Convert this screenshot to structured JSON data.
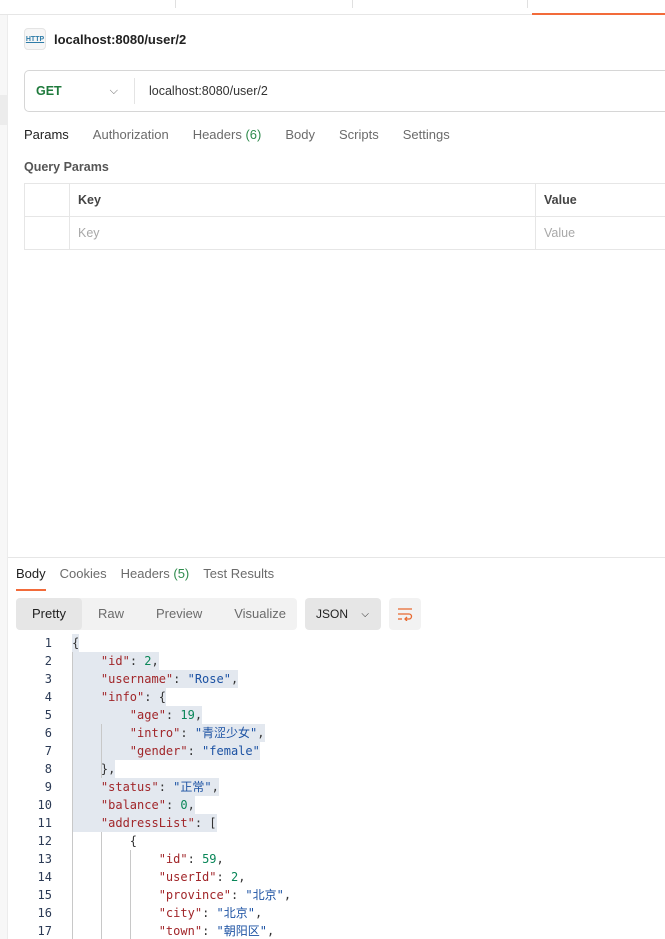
{
  "request": {
    "title": "localhost:8080/user/2",
    "icon": "http-icon",
    "icon_text": "HTTP",
    "method": "GET",
    "url": "localhost:8080/user/2"
  },
  "request_tabs": [
    {
      "label": "Params"
    },
    {
      "label": "Authorization"
    },
    {
      "label": "Headers",
      "count": "(6)"
    },
    {
      "label": "Body"
    },
    {
      "label": "Scripts"
    },
    {
      "label": "Settings"
    }
  ],
  "query_params": {
    "label": "Query Params",
    "columns": [
      "Key",
      "Value"
    ],
    "placeholders": [
      "Key",
      "Value"
    ]
  },
  "response_tabs": [
    {
      "label": "Body"
    },
    {
      "label": "Cookies"
    },
    {
      "label": "Headers",
      "count": "(5)"
    },
    {
      "label": "Test Results"
    }
  ],
  "view_modes": [
    "Pretty",
    "Raw",
    "Preview",
    "Visualize"
  ],
  "format": "JSON",
  "colors": {
    "accent": "#f26b3a",
    "method": "#1f7a3c",
    "key": "#a1262a",
    "string": "#1c52a3",
    "number": "#098658"
  },
  "code_lines": [
    {
      "n": "1",
      "hl": true,
      "tokens": [
        [
          "p",
          "{"
        ]
      ]
    },
    {
      "n": "2",
      "hl": true,
      "tokens": [
        [
          "p",
          "    "
        ],
        [
          "k",
          "\"id\""
        ],
        [
          "p",
          ": "
        ],
        [
          "n",
          "2"
        ],
        [
          "p",
          ","
        ]
      ]
    },
    {
      "n": "3",
      "hl": true,
      "tokens": [
        [
          "p",
          "    "
        ],
        [
          "k",
          "\"username\""
        ],
        [
          "p",
          ": "
        ],
        [
          "s",
          "\"Rose\""
        ],
        [
          "p",
          ","
        ]
      ]
    },
    {
      "n": "4",
      "hl": true,
      "tokens": [
        [
          "p",
          "    "
        ],
        [
          "k",
          "\"info\""
        ],
        [
          "p",
          ": {"
        ]
      ]
    },
    {
      "n": "5",
      "hl": true,
      "tokens": [
        [
          "p",
          "        "
        ],
        [
          "k",
          "\"age\""
        ],
        [
          "p",
          ": "
        ],
        [
          "n",
          "19"
        ],
        [
          "p",
          ","
        ]
      ]
    },
    {
      "n": "6",
      "hl": true,
      "tokens": [
        [
          "p",
          "        "
        ],
        [
          "k",
          "\"intro\""
        ],
        [
          "p",
          ": "
        ],
        [
          "s",
          "\"青涩少女\""
        ],
        [
          "p",
          ","
        ]
      ]
    },
    {
      "n": "7",
      "hl": true,
      "tokens": [
        [
          "p",
          "        "
        ],
        [
          "k",
          "\"gender\""
        ],
        [
          "p",
          ": "
        ],
        [
          "s",
          "\"female\""
        ]
      ]
    },
    {
      "n": "8",
      "hl": true,
      "tokens": [
        [
          "p",
          "    },"
        ]
      ]
    },
    {
      "n": "9",
      "hl": true,
      "tokens": [
        [
          "p",
          "    "
        ],
        [
          "k",
          "\"status\""
        ],
        [
          "p",
          ": "
        ],
        [
          "s",
          "\"正常\""
        ],
        [
          "p",
          ","
        ]
      ]
    },
    {
      "n": "10",
      "hl": true,
      "tokens": [
        [
          "p",
          "    "
        ],
        [
          "k",
          "\"balance\""
        ],
        [
          "p",
          ": "
        ],
        [
          "n",
          "0"
        ],
        [
          "p",
          ","
        ]
      ]
    },
    {
      "n": "11",
      "hl": true,
      "tokens": [
        [
          "p",
          "    "
        ],
        [
          "k",
          "\"addressList\""
        ],
        [
          "p",
          ": ["
        ]
      ]
    },
    {
      "n": "12",
      "hl": false,
      "tokens": [
        [
          "p",
          "        {"
        ]
      ]
    },
    {
      "n": "13",
      "hl": false,
      "tokens": [
        [
          "p",
          "            "
        ],
        [
          "k",
          "\"id\""
        ],
        [
          "p",
          ": "
        ],
        [
          "n",
          "59"
        ],
        [
          "p",
          ","
        ]
      ]
    },
    {
      "n": "14",
      "hl": false,
      "tokens": [
        [
          "p",
          "            "
        ],
        [
          "k",
          "\"userId\""
        ],
        [
          "p",
          ": "
        ],
        [
          "n",
          "2"
        ],
        [
          "p",
          ","
        ]
      ]
    },
    {
      "n": "15",
      "hl": false,
      "tokens": [
        [
          "p",
          "            "
        ],
        [
          "k",
          "\"province\""
        ],
        [
          "p",
          ": "
        ],
        [
          "s",
          "\"北京\""
        ],
        [
          "p",
          ","
        ]
      ]
    },
    {
      "n": "16",
      "hl": false,
      "tokens": [
        [
          "p",
          "            "
        ],
        [
          "k",
          "\"city\""
        ],
        [
          "p",
          ": "
        ],
        [
          "s",
          "\"北京\""
        ],
        [
          "p",
          ","
        ]
      ]
    },
    {
      "n": "17",
      "hl": false,
      "tokens": [
        [
          "p",
          "            "
        ],
        [
          "k",
          "\"town\""
        ],
        [
          "p",
          ": "
        ],
        [
          "s",
          "\"朝阳区\""
        ],
        [
          "p",
          ","
        ]
      ]
    }
  ]
}
